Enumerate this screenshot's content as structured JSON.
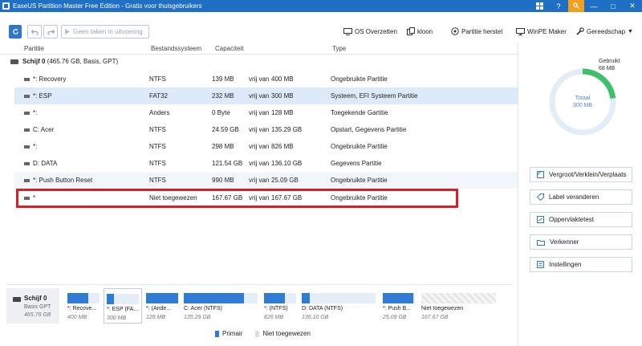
{
  "window": {
    "title": "EaseUS Partition Master Free Edition - Gratis voor thuisgebruikers"
  },
  "toolbar": {
    "pending_label": "Geen taken in uitvoering",
    "menu": [
      {
        "label": "OS Overzetten",
        "icon": "os-migrate-icon"
      },
      {
        "label": "kloon",
        "icon": "clone-icon"
      },
      {
        "label": "Partitie herstel",
        "icon": "partition-recovery-icon"
      },
      {
        "label": "WinPE Maker",
        "icon": "winpe-icon"
      },
      {
        "label": "Gereedschap",
        "icon": "tools-icon"
      }
    ]
  },
  "table": {
    "headers": [
      "Partitie",
      "Bestandssysteem",
      "Capaciteit",
      "Type"
    ],
    "disk": {
      "name": "Schijf 0",
      "details": "(465.76 GB, Basis, GPT)"
    },
    "rows": [
      {
        "name": "*: Recovery",
        "fs": "NTFS",
        "size": "139 MB",
        "free_label": "vrij van",
        "total": "400 MB",
        "type": "Ongebruikte Partitie"
      },
      {
        "name": "*: ESP",
        "fs": "FAT32",
        "size": "232 MB",
        "free_label": "vrij van",
        "total": "300 MB",
        "type": "Systeem, EFI Systeem Partitie"
      },
      {
        "name": "*:",
        "fs": "Anders",
        "size": "0 Byte",
        "free_label": "vrij van",
        "total": "128 MB",
        "type": "Toegekende Gartitie"
      },
      {
        "name": "C: Acer",
        "fs": "NTFS",
        "size": "24.59 GB",
        "free_label": "vrij van",
        "total": "135.29 GB",
        "type": "Opstart, Gegevens Partitie"
      },
      {
        "name": "*:",
        "fs": "NTFS",
        "size": "298 MB",
        "free_label": "vrij van",
        "total": "826 MB",
        "type": "Ongebruikte Partitie"
      },
      {
        "name": "D: DATA",
        "fs": "NTFS",
        "size": "121.54 GB",
        "free_label": "vrij van",
        "total": "136.10 GB",
        "type": "Gegevens Partitie"
      },
      {
        "name": "*: Push Button Reset",
        "fs": "NTFS",
        "size": "990 MB",
        "free_label": "vrij van",
        "total": "25.09 GB",
        "type": "Ongebruikte Partitie"
      },
      {
        "name": "*",
        "fs": "Niet toegewezen",
        "size": "167.67 GB",
        "free_label": "vrij van",
        "total": "167.67 GB",
        "type": "Ongebruikte Partitie"
      }
    ]
  },
  "side": {
    "used_label": "Gebruikt",
    "used_value": "68 MB",
    "total_label": "Totaal",
    "total_value": "300 MB",
    "used_fraction": 0.23,
    "actions": [
      {
        "label": "Vergroot/Verklein/Verplaats",
        "icon": "resize-icon"
      },
      {
        "label": "Label veranderen",
        "icon": "label-icon"
      },
      {
        "label": "Oppervlaktetest",
        "icon": "surface-test-icon"
      },
      {
        "label": "Verkenner",
        "icon": "explorer-icon"
      },
      {
        "label": "Instellingen",
        "icon": "settings-icon"
      }
    ]
  },
  "diskmap": {
    "disk_name": "Schijf 0",
    "disk_type": "Basis GPT",
    "disk_size": "465.76 GB",
    "segments": [
      {
        "label": "*: Recove...",
        "size": "400 MB",
        "fill": 0.65
      },
      {
        "label": "*: ESP (FA...",
        "size": "300 MB",
        "fill": 0.23
      },
      {
        "label": "*: (Ande...",
        "size": "128 MB",
        "fill": 1.0
      },
      {
        "label": "C: Acer (NTFS)",
        "size": "135.29 GB",
        "fill": 0.82
      },
      {
        "label": "*: (NTFS)",
        "size": "826 MB",
        "fill": 0.64
      },
      {
        "label": "D: DATA (NTFS)",
        "size": "136.10 GB",
        "fill": 0.11
      },
      {
        "label": "*: Push B...",
        "size": "25.09 GB",
        "fill": 0.96
      },
      {
        "label": "Niet toegewezen",
        "size": "167.67 GB",
        "fill": 0
      }
    ]
  },
  "legend": {
    "primary": "Primair",
    "unallocated": "Niet toegewezen"
  }
}
